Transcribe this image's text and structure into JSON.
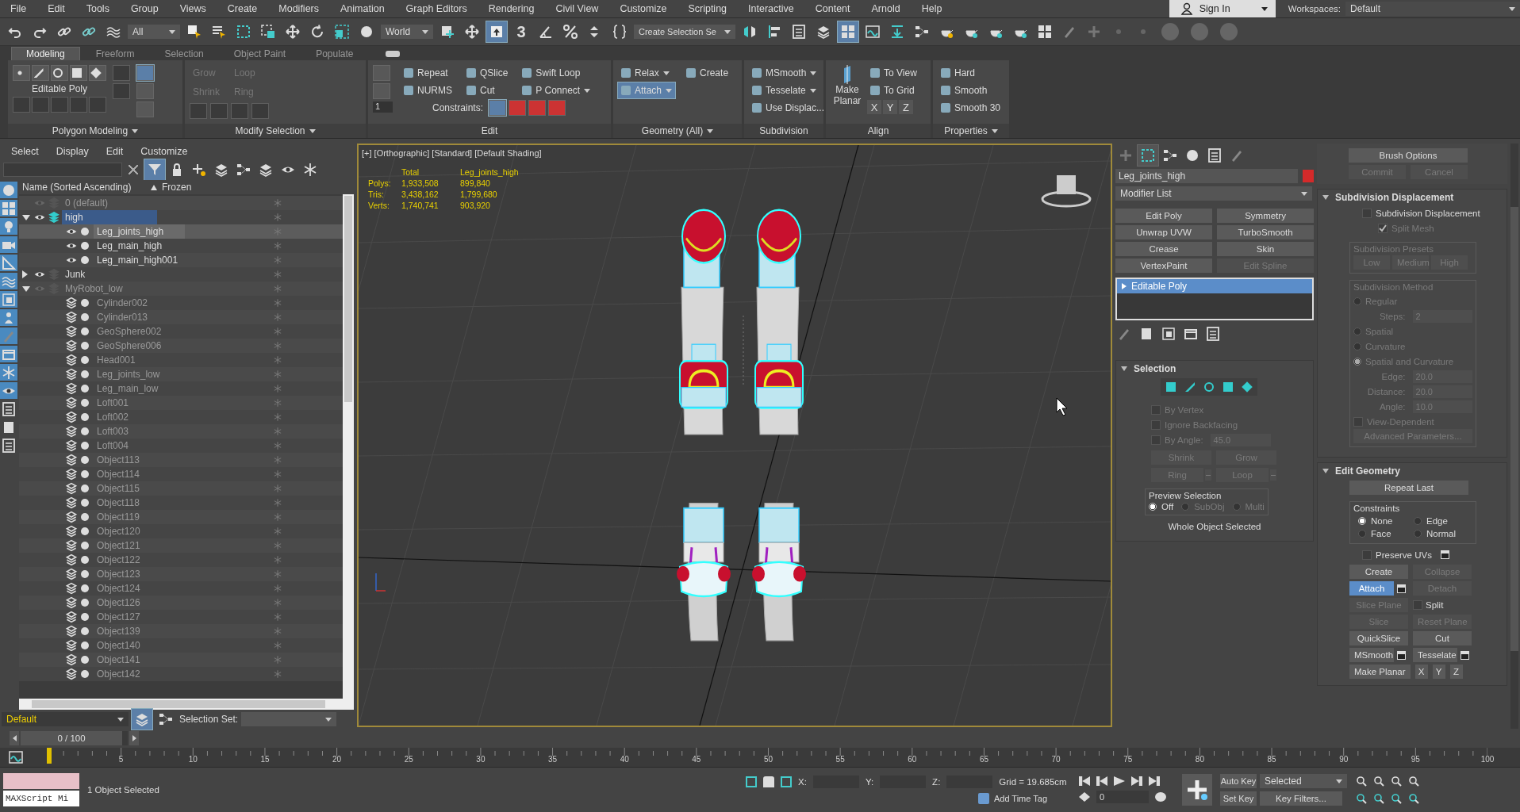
{
  "menu": [
    "File",
    "Edit",
    "Tools",
    "Group",
    "Views",
    "Create",
    "Modifiers",
    "Animation",
    "Graph Editors",
    "Rendering",
    "Civil View",
    "Customize",
    "Scripting",
    "Interactive",
    "Content",
    "Arnold",
    "Help"
  ],
  "account": {
    "label": "Sign In"
  },
  "workspaces": {
    "label": "Workspaces:",
    "value": "Default"
  },
  "toolbar": {
    "selection_filter": "All",
    "reference_coord": "World",
    "snap_label": "3",
    "named_selection": "Create Selection Se"
  },
  "ribbon_tabs": [
    {
      "label": "Modeling",
      "selected": true
    },
    {
      "label": "Freeform",
      "selected": false
    },
    {
      "label": "Selection",
      "selected": false
    },
    {
      "label": "Object Paint",
      "selected": false
    },
    {
      "label": "Populate",
      "selected": false
    }
  ],
  "ribbon": {
    "panels": [
      {
        "kind": "polygon",
        "footer": "Polygon Modeling",
        "footer_menu": true,
        "label": "Editable Poly"
      },
      {
        "kind": "modify",
        "footer": "Modify Selection",
        "footer_menu": true,
        "items": [
          {
            "label": "Grow",
            "disabled": true
          },
          {
            "label": "Shrink",
            "disabled": true
          },
          {
            "label": "Loop",
            "disabled": true
          },
          {
            "label": "Ring",
            "disabled": true
          }
        ]
      },
      {
        "kind": "edit",
        "footer": "Edit",
        "footer_menu": false,
        "spinner": "1",
        "constraints": "Constraints:",
        "items": [
          {
            "label": "Repeat",
            "dropdown": false
          },
          {
            "label": "QSlice",
            "dropdown": false
          },
          {
            "label": "Swift Loop",
            "dropdown": false
          },
          {
            "label": "NURMS",
            "dropdown": false
          },
          {
            "label": "Cut",
            "dropdown": false
          },
          {
            "label": "P Connect",
            "dropdown": true
          }
        ]
      },
      {
        "kind": "geometry",
        "footer": "Geometry (All)",
        "footer_menu": true,
        "items": [
          {
            "label": "Relax",
            "selected": false,
            "dropdown": true
          },
          {
            "label": "Create",
            "selected": false,
            "dropdown": false
          },
          {
            "label": "Attach",
            "selected": true,
            "dropdown": true
          }
        ]
      },
      {
        "kind": "subdivision",
        "footer": "Subdivision",
        "footer_menu": false,
        "items": [
          {
            "label": "MSmooth",
            "dropdown": true
          },
          {
            "label": "Tesselate",
            "dropdown": true
          },
          {
            "label": "Use Displac...",
            "dropdown": false
          }
        ]
      },
      {
        "kind": "align",
        "footer": "Align",
        "footer_menu": false,
        "planar": "Make Planar",
        "items": [
          {
            "label": "To View"
          },
          {
            "label": "To Grid"
          }
        ],
        "axes": [
          "X",
          "Y",
          "Z"
        ]
      },
      {
        "kind": "properties",
        "footer": "Properties",
        "footer_menu": true,
        "items": [
          {
            "label": "Hard"
          },
          {
            "label": "Smooth"
          },
          {
            "label": "Smooth 30"
          }
        ]
      }
    ]
  },
  "explorer": {
    "menu": [
      "Select",
      "Display",
      "Edit",
      "Customize"
    ],
    "columns": [
      "Name (Sorted Ascending)",
      "Frozen"
    ],
    "tree": [
      {
        "name": "0 (default)",
        "hidden": true,
        "current": false
      },
      {
        "name": "high",
        "hidden": false,
        "current": true,
        "expanded": true,
        "children": [
          {
            "name": "Leg_joints_high",
            "hidden": false,
            "selected": true
          },
          {
            "name": "Leg_main_high",
            "hidden": false,
            "selected": false
          },
          {
            "name": "Leg_main_high001",
            "hidden": false,
            "selected": false
          }
        ]
      },
      {
        "name": "Junk",
        "hidden": false,
        "current": false,
        "expanded": false
      },
      {
        "name": "MyRobot_low",
        "hidden": true,
        "current": false,
        "expanded": true,
        "children": [
          {
            "name": "Cylinder002",
            "hidden": true,
            "selected": false
          },
          {
            "name": "Cylinder013",
            "hidden": true,
            "selected": false
          },
          {
            "name": "GeoSphere002",
            "hidden": true,
            "selected": false
          },
          {
            "name": "GeoSphere006",
            "hidden": true,
            "selected": false
          },
          {
            "name": "Head001",
            "hidden": true,
            "selected": false
          },
          {
            "name": "Leg_joints_low",
            "hidden": true,
            "selected": false
          },
          {
            "name": "Leg_main_low",
            "hidden": true,
            "selected": false
          },
          {
            "name": "Loft001",
            "hidden": true,
            "selected": false
          },
          {
            "name": "Loft002",
            "hidden": true,
            "selected": false
          },
          {
            "name": "Loft003",
            "hidden": true,
            "selected": false
          },
          {
            "name": "Loft004",
            "hidden": true,
            "selected": false
          },
          {
            "name": "Object113",
            "hidden": true,
            "selected": false
          },
          {
            "name": "Object114",
            "hidden": true,
            "selected": false
          },
          {
            "name": "Object115",
            "hidden": true,
            "selected": false
          },
          {
            "name": "Object118",
            "hidden": true,
            "selected": false
          },
          {
            "name": "Object119",
            "hidden": true,
            "selected": false
          },
          {
            "name": "Object120",
            "hidden": true,
            "selected": false
          },
          {
            "name": "Object121",
            "hidden": true,
            "selected": false
          },
          {
            "name": "Object122",
            "hidden": true,
            "selected": false
          },
          {
            "name": "Object123",
            "hidden": true,
            "selected": false
          },
          {
            "name": "Object124",
            "hidden": true,
            "selected": false
          },
          {
            "name": "Object126",
            "hidden": true,
            "selected": false
          },
          {
            "name": "Object127",
            "hidden": true,
            "selected": false
          },
          {
            "name": "Object139",
            "hidden": true,
            "selected": false
          },
          {
            "name": "Object140",
            "hidden": true,
            "selected": false
          },
          {
            "name": "Object141",
            "hidden": true,
            "selected": false
          },
          {
            "name": "Object142",
            "hidden": true,
            "selected": false
          }
        ]
      }
    ],
    "layer_dropdown": "Default",
    "selection_set": "Selection Set:"
  },
  "viewport": {
    "label": "[+] [Orthographic] [Standard] [Default Shading]",
    "stats": {
      "headers": [
        "Total",
        "Leg_joints_high"
      ],
      "rows": [
        {
          "label": "Polys:",
          "total": "1,933,508",
          "object": "899,840"
        },
        {
          "label": "Tris:",
          "total": "3,438,162",
          "object": "1,799,680"
        },
        {
          "label": "Verts:",
          "total": "1,740,741",
          "object": "903,920"
        }
      ]
    }
  },
  "command_panel": {
    "tabs": [
      {
        "kind": "create",
        "selected": false
      },
      {
        "kind": "modify",
        "selected": true
      },
      {
        "kind": "hierarchy",
        "selected": false
      },
      {
        "kind": "motion",
        "selected": false
      },
      {
        "kind": "display",
        "selected": false
      },
      {
        "kind": "utilities",
        "selected": false
      }
    ],
    "object_name": "Leg_joints_high",
    "modifier_list": "Modifier List",
    "modifier_buttons": [
      {
        "label": "Edit Poly",
        "disabled": false
      },
      {
        "label": "Symmetry",
        "disabled": false
      },
      {
        "label": "Unwrap UVW",
        "disabled": false
      },
      {
        "label": "TurboSmooth",
        "disabled": false
      },
      {
        "label": "Crease",
        "disabled": false
      },
      {
        "label": "Skin",
        "disabled": false
      },
      {
        "label": "VertexPaint",
        "disabled": false
      },
      {
        "label": "Edit Spline",
        "disabled": true
      }
    ],
    "stack": [
      {
        "label": "Editable Poly",
        "selected": true
      }
    ],
    "selection": {
      "title": "Selection",
      "expanded": true,
      "checkboxes": [
        {
          "label": "By Vertex",
          "checked": false,
          "disabled": true
        },
        {
          "label": "Ignore Backfacing",
          "checked": false,
          "disabled": true
        }
      ],
      "by_angle": {
        "label": "By Angle:",
        "value": "45.0",
        "checked": false,
        "disabled": true
      },
      "buttons": [
        {
          "label": "Shrink",
          "disabled": true,
          "spinner": false
        },
        {
          "label": "Grow",
          "disabled": true,
          "spinner": false
        },
        {
          "label": "Ring",
          "disabled": true,
          "spinner": true
        },
        {
          "label": "Loop",
          "disabled": true,
          "spinner": true
        }
      ],
      "preview": {
        "label": "Preview Selection",
        "options": [
          {
            "label": "Off",
            "selected": true,
            "disabled": false
          },
          {
            "label": "SubObj",
            "selected": false,
            "disabled": true
          },
          {
            "label": "Multi",
            "selected": false,
            "disabled": true
          }
        ]
      },
      "status": "Whole Object Selected"
    },
    "brush": {
      "main": {
        "label": "Brush Options",
        "disabled": false
      },
      "pair": [
        {
          "label": "Commit",
          "disabled": true
        },
        {
          "label": "Cancel",
          "disabled": true
        }
      ]
    },
    "subdiv": {
      "title": "Subdivision Displacement",
      "expanded": true,
      "checkbox": {
        "label": "Subdivision Displacement",
        "checked": false,
        "disabled": false
      },
      "split": {
        "label": "Split Mesh",
        "checked": true,
        "disabled": true
      },
      "presets": {
        "label": "Subdivision Presets",
        "disabled": true,
        "buttons": [
          "Low",
          "Medium",
          "High"
        ]
      },
      "method": {
        "label": "Subdivision Method",
        "disabled": true,
        "items": [
          {
            "kind": "radio",
            "label": "Regular",
            "selected": false
          },
          {
            "kind": "spinner",
            "label": "Steps:",
            "value": "2"
          },
          {
            "kind": "radio",
            "label": "Spatial",
            "selected": false
          },
          {
            "kind": "radio",
            "label": "Curvature",
            "selected": false
          },
          {
            "kind": "radio",
            "label": "Spatial and Curvature",
            "selected": true
          },
          {
            "kind": "spinner",
            "label": "Edge:",
            "value": "20.0"
          },
          {
            "kind": "spinner",
            "label": "Distance:",
            "value": "20.0"
          },
          {
            "kind": "spinner",
            "label": "Angle:",
            "value": "10.0"
          }
        ],
        "view_dependent": {
          "label": "View-Dependent",
          "checked": false
        },
        "advanced": "Advanced Parameters..."
      }
    },
    "edit_geometry": {
      "title": "Edit Geometry",
      "expanded": true,
      "repeat": "Repeat Last",
      "constraints": {
        "label": "Constraints",
        "options": [
          {
            "label": "None",
            "selected": true
          },
          {
            "label": "Edge",
            "selected": false
          },
          {
            "label": "Face",
            "selected": false
          },
          {
            "label": "Normal",
            "selected": false
          }
        ]
      },
      "preserve": {
        "label": "Preserve UVs",
        "checked": false
      },
      "rows": [
        [
          {
            "kind": "button",
            "label": "Create",
            "disabled": false,
            "selected": false,
            "settings": false
          },
          {
            "kind": "button",
            "label": "Collapse",
            "disabled": true,
            "selected": false,
            "settings": false
          }
        ],
        [
          {
            "kind": "button",
            "label": "Attach",
            "disabled": false,
            "selected": true,
            "settings": true
          },
          {
            "kind": "button",
            "label": "Detach",
            "disabled": true,
            "selected": false,
            "settings": false
          }
        ],
        [
          {
            "kind": "button",
            "label": "Slice Plane",
            "disabled": true,
            "selected": false,
            "settings": false
          },
          {
            "kind": "checkbox",
            "label": "Split",
            "checked": false
          }
        ],
        [
          {
            "kind": "button",
            "label": "Slice",
            "disabled": true,
            "selected": false,
            "settings": false
          },
          {
            "kind": "button",
            "label": "Reset Plane",
            "disabled": true,
            "selected": false,
            "settings": false
          }
        ],
        [
          {
            "kind": "button",
            "label": "QuickSlice",
            "disabled": false,
            "selected": false,
            "settings": false
          },
          {
            "kind": "button",
            "label": "Cut",
            "disabled": false,
            "selected": false,
            "settings": false
          }
        ],
        [
          {
            "kind": "button",
            "label": "MSmooth",
            "disabled": false,
            "selected": false,
            "settings": true
          },
          {
            "kind": "button",
            "label": "Tesselate",
            "disabled": false,
            "selected": false,
            "settings": true
          }
        ]
      ],
      "planar": "Make Planar",
      "axes": [
        "X",
        "Y",
        "Z"
      ]
    }
  },
  "time_slider": {
    "label": "0 / 100",
    "level": 0
  },
  "ruler": {
    "labels": [
      "5",
      "10",
      "15",
      "20",
      "25",
      "30",
      "35",
      "40",
      "45",
      "50",
      "55",
      "60",
      "65",
      "70",
      "75",
      "80",
      "85",
      "90",
      "95",
      "100"
    ]
  },
  "status": {
    "script_listener": "MAXScript Mi",
    "message": "1 Object Selected",
    "coords": [
      "X:",
      "Y:",
      "Z:"
    ],
    "grid": "Grid = 19.685cm",
    "time_tag": "Add Time Tag",
    "frame": "0",
    "auto_key": "Auto Key",
    "key_mode": "Selected",
    "set_key": "Set Key",
    "key_filters": "Key Filters..."
  }
}
